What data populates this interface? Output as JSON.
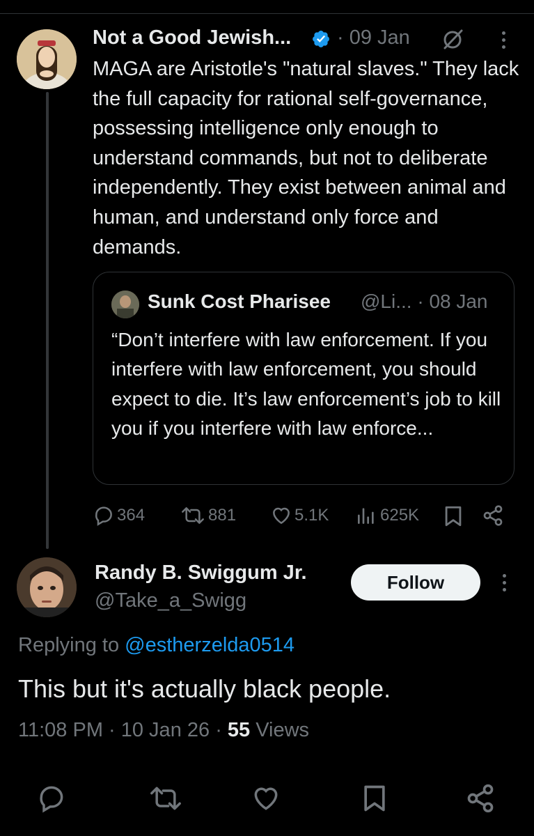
{
  "tweet": {
    "author_name": "Not a Good Jewish...",
    "date": "· 09 Jan",
    "text": "MAGA are Aristotle's \"natural slaves.\" They lack the full capacity for rational self-governance, possessing intelligence only enough to understand commands, but not to deliberate independently. They exist between animal and human, and understand only force and demands.",
    "verified": true,
    "quote": {
      "author_name": "Sunk Cost Pharisee",
      "handle_date": "@Li... · 08 Jan",
      "text": "“Don’t interfere with law enforcement. If you interfere with law enforcement, you should expect to die. It’s law enforcement’s job to kill you if you interfere with law enforce..."
    },
    "stats": {
      "replies": "364",
      "reposts": "881",
      "likes": "5.1K",
      "views": "625K"
    }
  },
  "reply": {
    "author_name": "Randy B. Swiggum Jr.",
    "handle": "@Take_a_Swigg",
    "follow_label": "Follow",
    "replying_to_prefix": "Replying to ",
    "replying_to_handle": "@estherzelda0514",
    "text": "This but it's actually black people.",
    "time": "11:08 PM · 10 Jan 26 · ",
    "views_count": "55",
    "views_label": " Views"
  },
  "icons": [
    "verified-badge-icon",
    "grok-icon",
    "more-icon",
    "reply-icon",
    "repost-icon",
    "like-icon",
    "views-icon",
    "bookmark-icon",
    "share-icon"
  ],
  "colors": {
    "background": "#000000",
    "text": "#e7e9ea",
    "muted": "#71767b",
    "link": "#1d9bf0",
    "verified": "#1d9bf0",
    "follow_bg": "#eff3f4"
  }
}
